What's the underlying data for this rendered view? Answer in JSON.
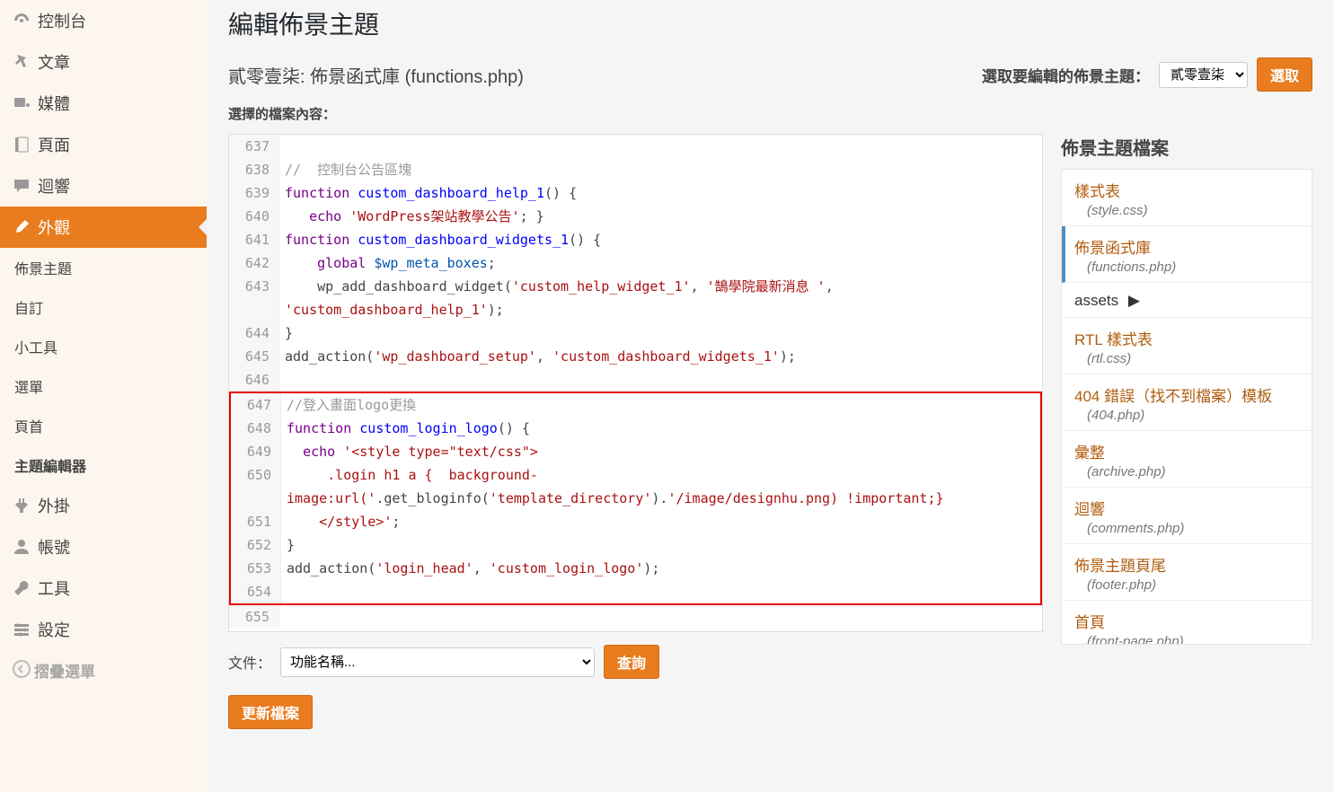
{
  "sidebar": {
    "items": [
      {
        "icon": "dashboard",
        "label": "控制台"
      },
      {
        "icon": "pin",
        "label": "文章"
      },
      {
        "icon": "media",
        "label": "媒體"
      },
      {
        "icon": "page",
        "label": "頁面"
      },
      {
        "icon": "comment",
        "label": "迴響"
      },
      {
        "icon": "appearance",
        "label": "外觀"
      },
      {
        "icon": "plugin",
        "label": "外掛"
      },
      {
        "icon": "user",
        "label": "帳號"
      },
      {
        "icon": "tool",
        "label": "工具"
      },
      {
        "icon": "settings",
        "label": "設定"
      }
    ],
    "sub": [
      "佈景主題",
      "自訂",
      "小工具",
      "選單",
      "頁首",
      "主題編輯器"
    ],
    "collapse": "摺疊選單"
  },
  "page": {
    "title": "編輯佈景主題",
    "file_heading": "貳零壹柒: 佈景函式庫 (functions.php)",
    "select_theme_label": "選取要編輯的佈景主題：",
    "select_theme_value": "貳零壹柒",
    "select_btn": "選取",
    "content_label": "選擇的檔案內容：",
    "doc_label": "文件：",
    "doc_placeholder": "功能名稱...",
    "query_btn": "查詢",
    "update_btn": "更新檔案"
  },
  "code": {
    "lines": [
      {
        "n": 637,
        "r": ""
      },
      {
        "n": 638,
        "r": "<span class='tok-comment'>//  控制台公告區塊</span>"
      },
      {
        "n": 639,
        "r": "<span class='tok-keyword'>function</span> <span class='tok-func'>custom_dashboard_help_1</span>() {"
      },
      {
        "n": 640,
        "r": "   <span class='tok-keyword'>echo</span> <span class='tok-string'>'WordPress架站教學公告'</span>; }"
      },
      {
        "n": 641,
        "r": "<span class='tok-keyword'>function</span> <span class='tok-func'>custom_dashboard_widgets_1</span>() {"
      },
      {
        "n": 642,
        "r": "    <span class='tok-keyword'>global</span> <span class='tok-var'>$wp_meta_boxes</span>;"
      },
      {
        "n": 643,
        "r": "    wp_add_dashboard_widget(<span class='tok-string'>'custom_help_widget_1'</span>, <span class='tok-string'>'鵠學院最新消息 '</span>, <span class='tok-string'>'custom_dashboard_help_1'</span>);"
      },
      {
        "n": 644,
        "r": "}"
      },
      {
        "n": 645,
        "r": "add_action(<span class='tok-string'>'wp_dashboard_setup'</span>, <span class='tok-string'>'custom_dashboard_widgets_1'</span>);"
      },
      {
        "n": 646,
        "r": ""
      },
      {
        "n": 647,
        "r": "<span class='tok-comment'>//登入畫面logo更換</span>",
        "hl": true
      },
      {
        "n": 648,
        "r": "<span class='tok-keyword'>function</span> <span class='tok-func'>custom_login_logo</span>() {",
        "hl": true
      },
      {
        "n": 649,
        "r": "  <span class='tok-keyword'>echo</span> <span class='tok-string'>'&lt;style type=\"text/css\"&gt;</span>",
        "hl": true
      },
      {
        "n": 650,
        "r": "<span class='tok-string'>     .login h1 a {  background-image:url('</span>.get_bloginfo(<span class='tok-string'>'template_directory'</span>).<span class='tok-string'>'/image/designhu.png) !important;}</span>",
        "hl": true
      },
      {
        "n": 651,
        "r": "<span class='tok-string'>    &lt;/style&gt;'</span>;",
        "hl": true
      },
      {
        "n": 652,
        "r": "}",
        "hl": true
      },
      {
        "n": 653,
        "r": "add_action(<span class='tok-string'>'login_head'</span>, <span class='tok-string'>'custom_login_logo'</span>);",
        "hl": true
      },
      {
        "n": 654,
        "r": "",
        "hl": true
      },
      {
        "n": 655,
        "r": ""
      }
    ]
  },
  "files": {
    "heading": "佈景主題檔案",
    "items": [
      {
        "name": "樣式表",
        "sub": "(style.css)"
      },
      {
        "name": "佈景函式庫",
        "sub": "(functions.php)",
        "active": true
      },
      {
        "name": "assets",
        "folder": true
      },
      {
        "name": "RTL 樣式表",
        "sub": "(rtl.css)"
      },
      {
        "name": "404 錯誤（找不到檔案）模板",
        "sub": "(404.php)"
      },
      {
        "name": "彙整",
        "sub": "(archive.php)"
      },
      {
        "name": "迴響",
        "sub": "(comments.php)"
      },
      {
        "name": "佈景主題頁尾",
        "sub": "(footer.php)"
      },
      {
        "name": "首頁",
        "sub": "(front-page.php)"
      }
    ]
  }
}
